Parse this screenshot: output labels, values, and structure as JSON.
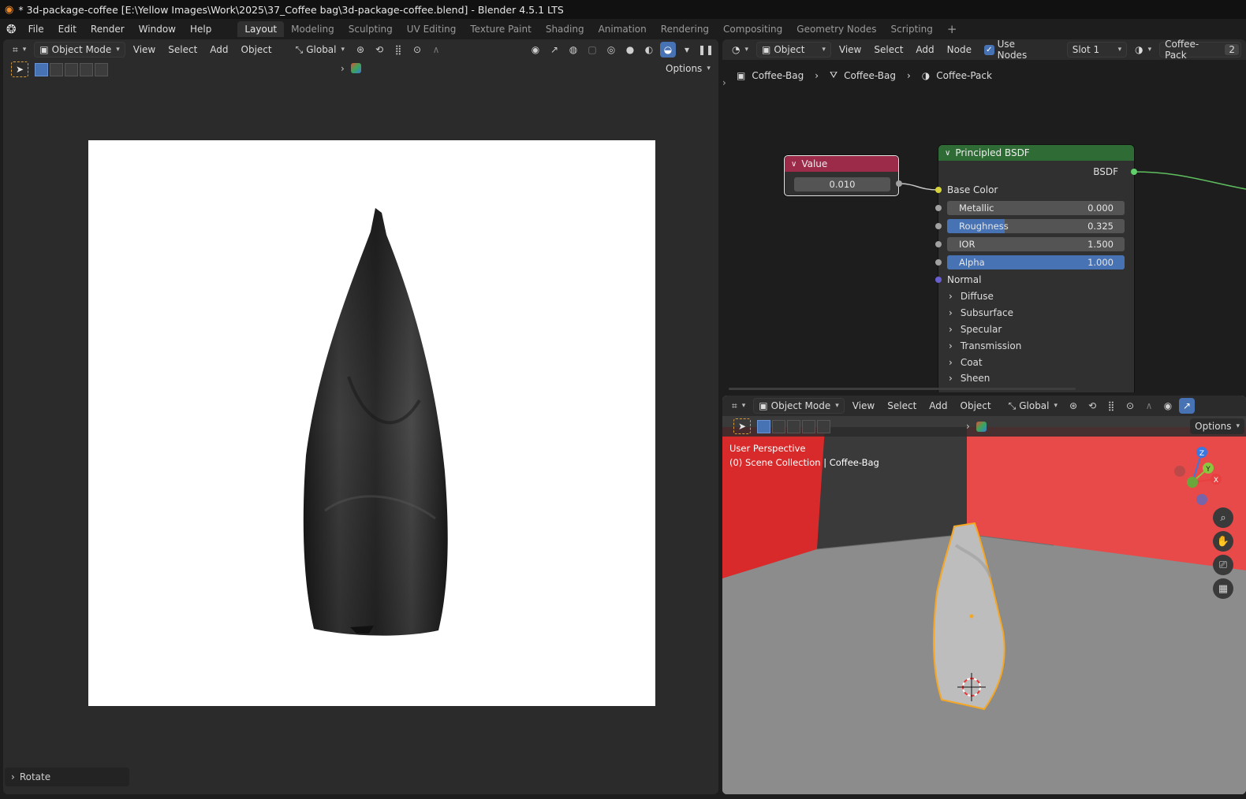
{
  "window": {
    "title": "* 3d-package-coffee [E:\\Yellow Images\\Work\\2025\\37_Coffee bag\\3d-package-coffee.blend] - Blender 4.5.1 LTS"
  },
  "menu": [
    "File",
    "Edit",
    "Render",
    "Window",
    "Help"
  ],
  "workspaces": [
    "Layout",
    "Modeling",
    "Sculpting",
    "UV Editing",
    "Texture Paint",
    "Shading",
    "Animation",
    "Rendering",
    "Compositing",
    "Geometry Nodes",
    "Scripting"
  ],
  "workspace_add": "+",
  "left_viewport": {
    "mode": "Object Mode",
    "menus": [
      "View",
      "Select",
      "Add",
      "Object"
    ],
    "transform": "Global",
    "options": "Options",
    "last_op": "Rotate",
    "bg_color": "#ffffff"
  },
  "node_editor": {
    "type": "Object",
    "menus": [
      "View",
      "Select",
      "Add",
      "Node"
    ],
    "use_nodes_label": "Use Nodes",
    "use_nodes": true,
    "slot": "Slot 1",
    "material": "Coffee-Pack",
    "user_count": "2",
    "breadcrumb": [
      "Coffee-Bag",
      "Coffee-Bag",
      "Coffee-Pack"
    ],
    "value_node": {
      "title": "Value",
      "value": "0.010",
      "color": "#9b2b48"
    },
    "bsdf_node": {
      "title": "Principled BSDF",
      "output": "BSDF",
      "color": "#2e6b35",
      "base_color": "Base Color",
      "fields": [
        {
          "label": "Metallic",
          "value": "0.000",
          "fill": 0
        },
        {
          "label": "Roughness",
          "value": "0.325",
          "fill": 0.325
        },
        {
          "label": "IOR",
          "value": "1.500",
          "fill": 0
        },
        {
          "label": "Alpha",
          "value": "1.000",
          "fill": 1
        }
      ],
      "normal": "Normal",
      "panels": [
        "Diffuse",
        "Subsurface",
        "Specular",
        "Transmission",
        "Coat",
        "Sheen"
      ]
    }
  },
  "right_viewport": {
    "mode": "Object Mode",
    "menus": [
      "View",
      "Select",
      "Add",
      "Object"
    ],
    "transform": "Global",
    "options": "Options",
    "perspective": "User Perspective",
    "collection": "(0) Scene Collection | Coffee-Bag",
    "gizmo_axes": {
      "z": "Z",
      "y": "Y",
      "x": "X"
    },
    "colors": {
      "wall": "#e33c3c",
      "floor": "#8e8e8e",
      "selection": "#f5a623"
    }
  }
}
